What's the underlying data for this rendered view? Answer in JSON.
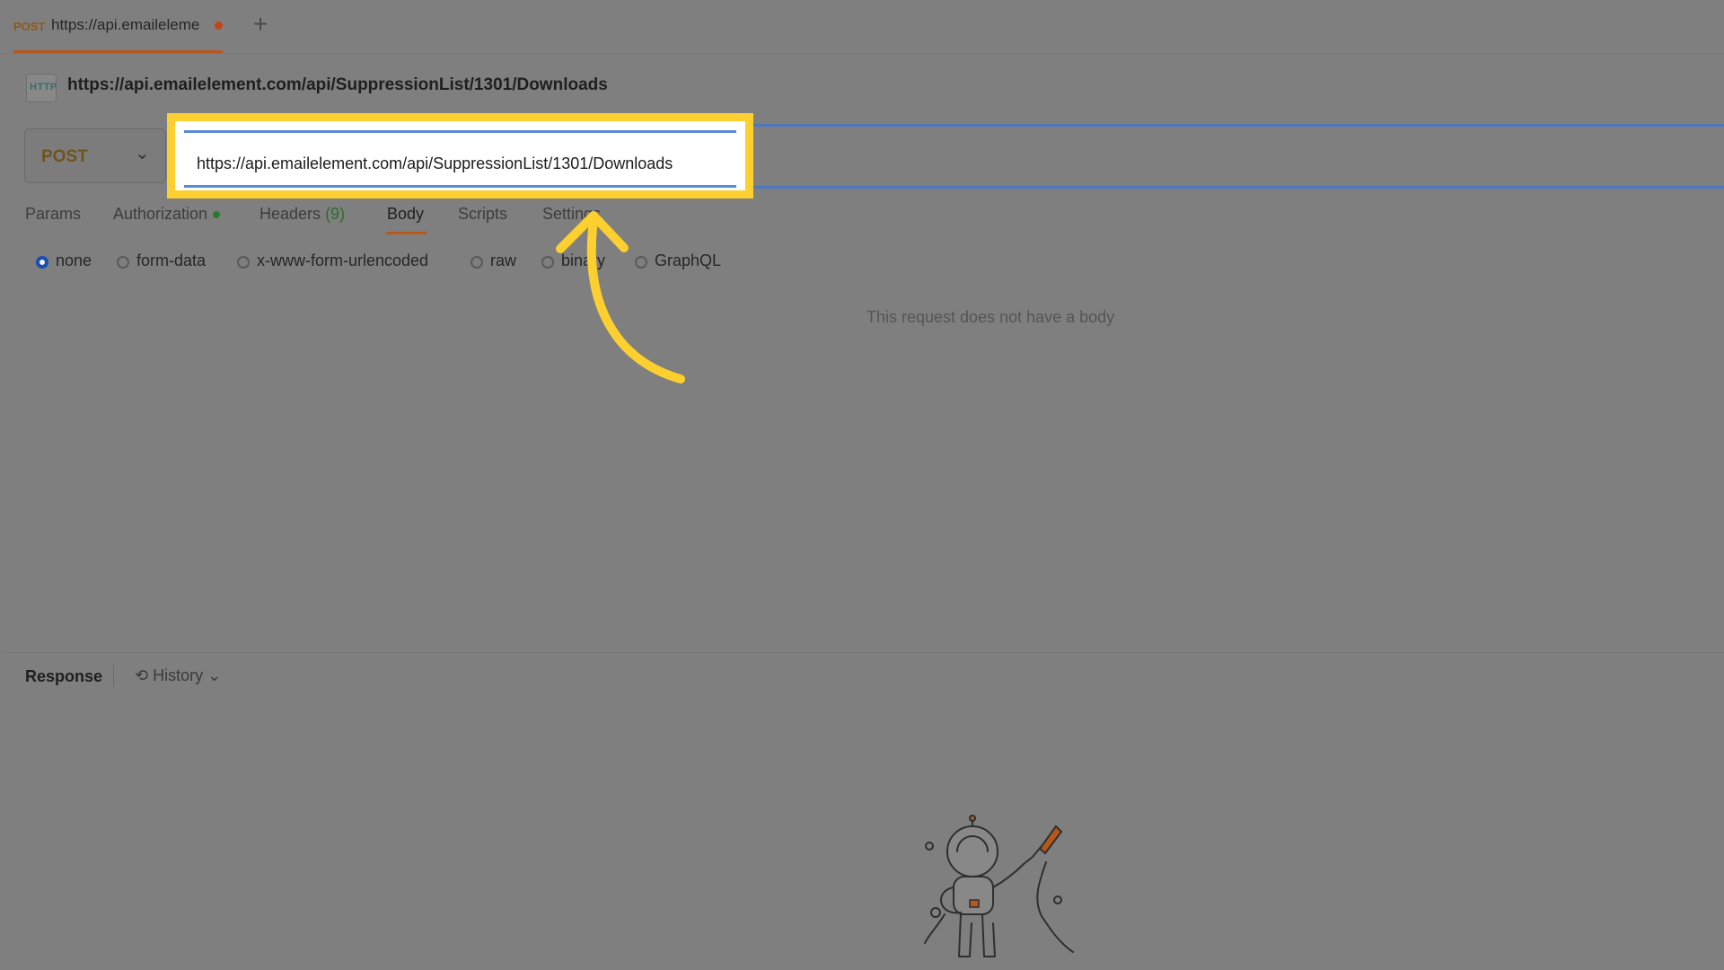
{
  "tab": {
    "method": "POST",
    "title": "https://api.emaileleme",
    "new_tab_icon": "+"
  },
  "breadcrumb": {
    "icon_label": "HTTP",
    "url": "https://api.emailelement.com/api/SuppressionList/1301/Downloads"
  },
  "request": {
    "method": "POST",
    "url": "https://api.emailelement.com/api/SuppressionList/1301/Downloads"
  },
  "subtabs": {
    "params": "Params",
    "authorization": "Authorization",
    "headers": "Headers",
    "headers_count": "(9)",
    "body": "Body",
    "scripts": "Scripts",
    "settings": "Settings"
  },
  "body_options": {
    "none": "none",
    "form_data": "form-data",
    "urlencoded": "x-www-form-urlencoded",
    "raw": "raw",
    "binary": "binary",
    "graphql": "GraphQL",
    "selected": "none"
  },
  "body_empty_message": "This request does not have a body",
  "response": {
    "label": "Response",
    "history": "History"
  },
  "colors": {
    "highlight": "#fdcf2f",
    "accent": "#b5581c",
    "url_border": "#4d78c0"
  }
}
